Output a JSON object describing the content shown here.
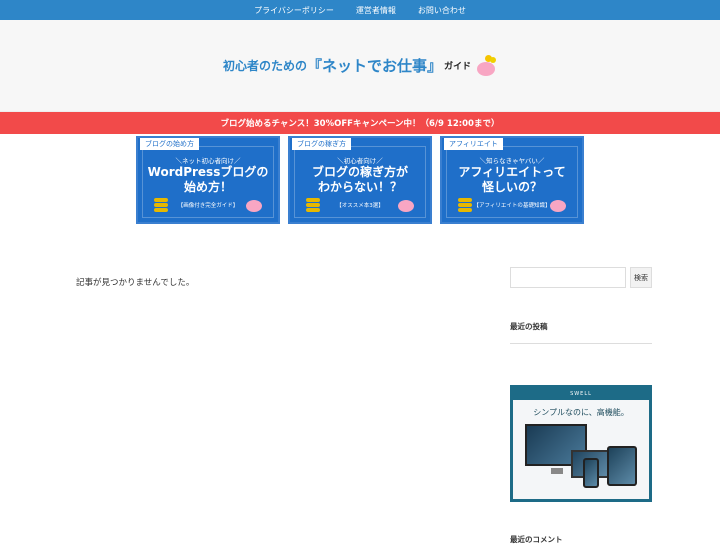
{
  "topnav": {
    "items": [
      "プライバシーポリシー",
      "運営者情報",
      "お問い合わせ"
    ]
  },
  "header": {
    "logo_part1": "初心者のための",
    "logo_part2": "『ネットでお仕事』",
    "logo_part3": "ガイド"
  },
  "banner": {
    "text": "ブログ始めるチャンス！30%OFFキャンペーン中！（6/9 12:00まで）"
  },
  "cards": [
    {
      "tag": "ブログの始め方",
      "sub": "＼ネット初心者向け／",
      "main1": "WordPressブログの",
      "main2": "始め方！",
      "note": "【画像付き完全ガイド】"
    },
    {
      "tag": "ブログの稼ぎ方",
      "sub": "＼初心者向け／",
      "main1": "ブログの稼ぎ方が",
      "main2": "わからない！？",
      "note": "【オススメ本3選】"
    },
    {
      "tag": "アフィリエイト",
      "sub": "＼知らなきゃヤバい／",
      "main1": "アフィリエイトって",
      "main2": "怪しいの？",
      "note": "【アフィリエイトの基礎知識】"
    }
  ],
  "content": {
    "message": "記事が見つかりませんでした。"
  },
  "sidebar": {
    "search_button": "検索",
    "recent_posts_title": "最近の投稿",
    "ad_brand": "SWELL",
    "ad_tagline": "シンプルなのに、高機能。",
    "next_title": "最近のコメント"
  },
  "colors": {
    "nav_blue": "#2e86c8",
    "banner_red": "#f24a4a",
    "card_blue": "#1f6fc9",
    "ad_teal": "#1d6b87"
  }
}
